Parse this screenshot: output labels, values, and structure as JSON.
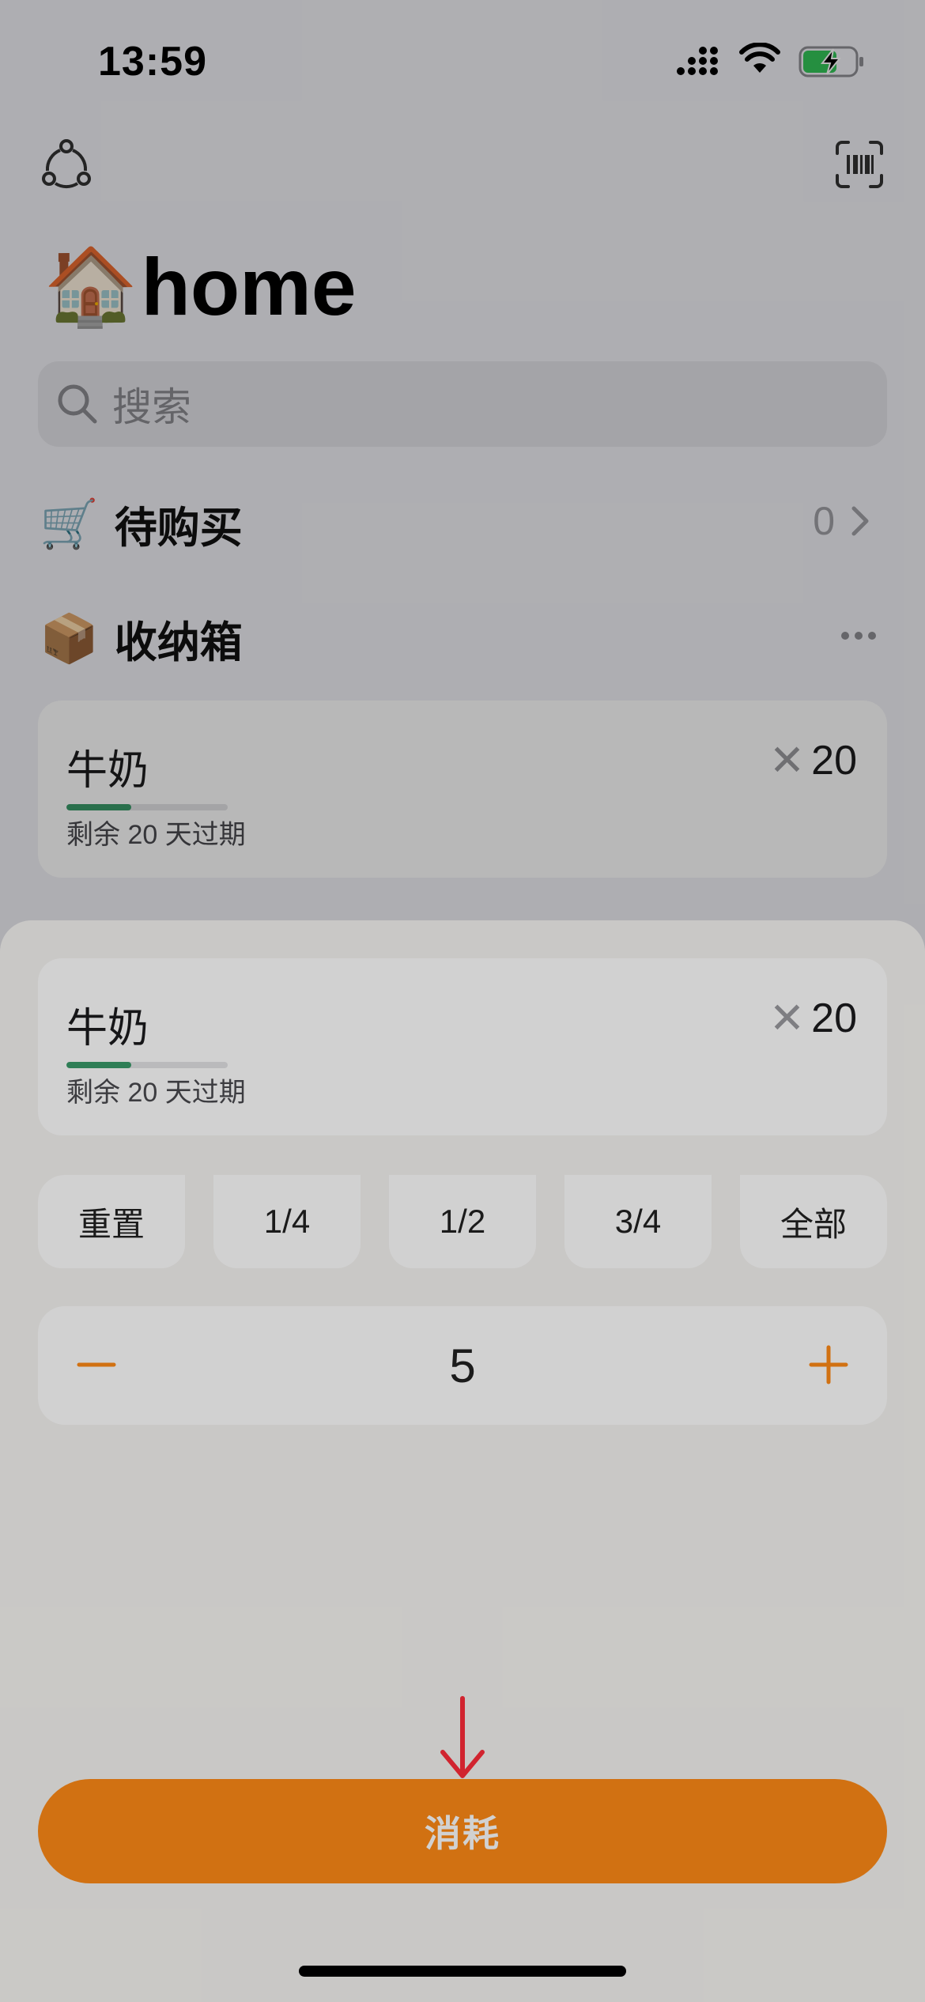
{
  "status_bar": {
    "time": "13:59"
  },
  "header": {
    "title_emoji": "🏠",
    "title": "home"
  },
  "search": {
    "placeholder": "搜索"
  },
  "to_buy": {
    "emoji": "🛒",
    "label": "待购买",
    "count": "0"
  },
  "storage": {
    "emoji": "📦",
    "label": "收纳箱"
  },
  "item": {
    "name": "牛奶",
    "quantity_symbol": "✕",
    "quantity": "20",
    "expiry_text": "剩余 20 天过期",
    "expiry_progress": 0.4
  },
  "sheet": {
    "chips": [
      "重置",
      "1/4",
      "1/2",
      "3/4",
      "全部"
    ],
    "stepper_value": "5",
    "consume_label": "消耗"
  },
  "colors": {
    "accent": "#ff8a17",
    "expiry_bar": "#3a9a6a",
    "annotation_arrow": "#ff2d3a"
  }
}
